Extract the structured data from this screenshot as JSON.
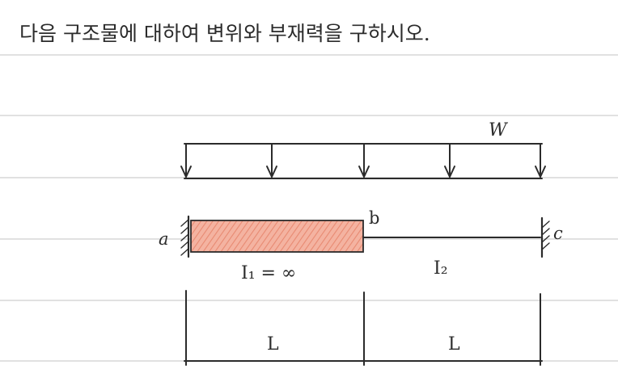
{
  "header": {
    "instruction": "다음 구조물에 대하여 변위와 부재력을 구하시오."
  },
  "load": {
    "label": "W"
  },
  "beam": {
    "support_a_label": "a",
    "joint_b_label": "b",
    "support_c_label": "c",
    "segment_ab_inertia": "I₁ = ∞",
    "segment_bc_inertia": "I₂",
    "segment_ab_fill_color": "#f0a28c"
  },
  "dimensions": {
    "span_ab": "L",
    "span_bc": "L"
  }
}
